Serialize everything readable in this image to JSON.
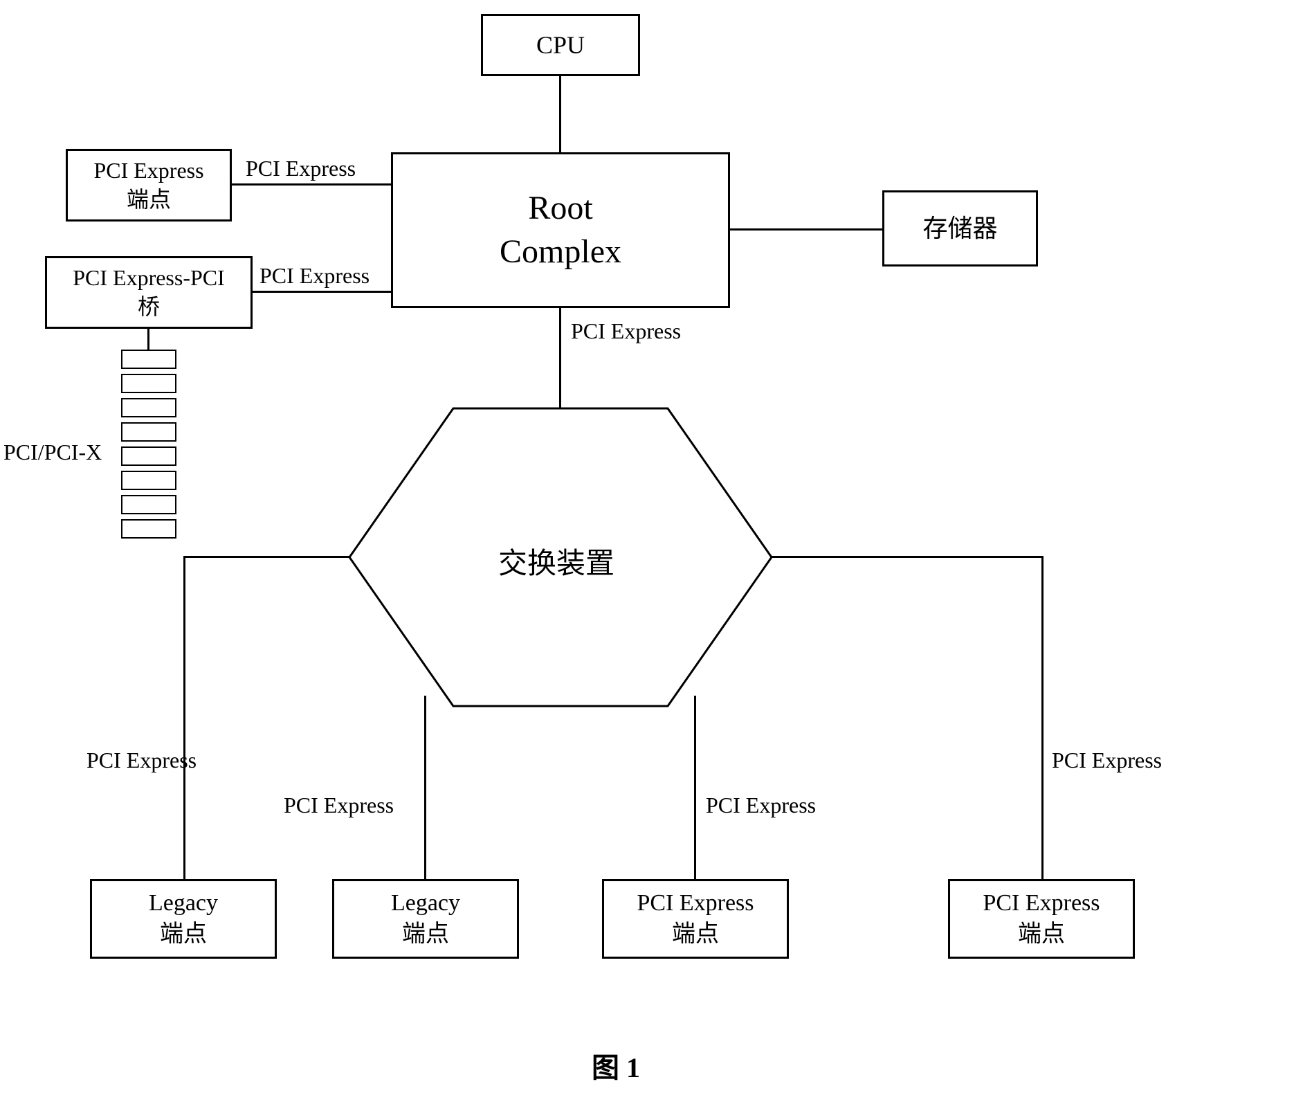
{
  "nodes": {
    "cpu": "CPU",
    "root_complex_line1": "Root",
    "root_complex_line2": "Complex",
    "memory": "存储器",
    "pci_express_endpoint_line1": "PCI Express",
    "pci_express_endpoint_line2": "端点",
    "pci_bridge_line1": "PCI Express-PCI",
    "pci_bridge_line2": "桥",
    "switch": "交换装置",
    "legacy_endpoint_line1": "Legacy",
    "legacy_endpoint_line2": "端点",
    "pcie_endpoint_line1": "PCI Express",
    "pcie_endpoint_line2": "端点"
  },
  "labels": {
    "pci_express": "PCI Express",
    "pci_pcix": "PCI/PCI-X"
  },
  "figure": "图 1"
}
